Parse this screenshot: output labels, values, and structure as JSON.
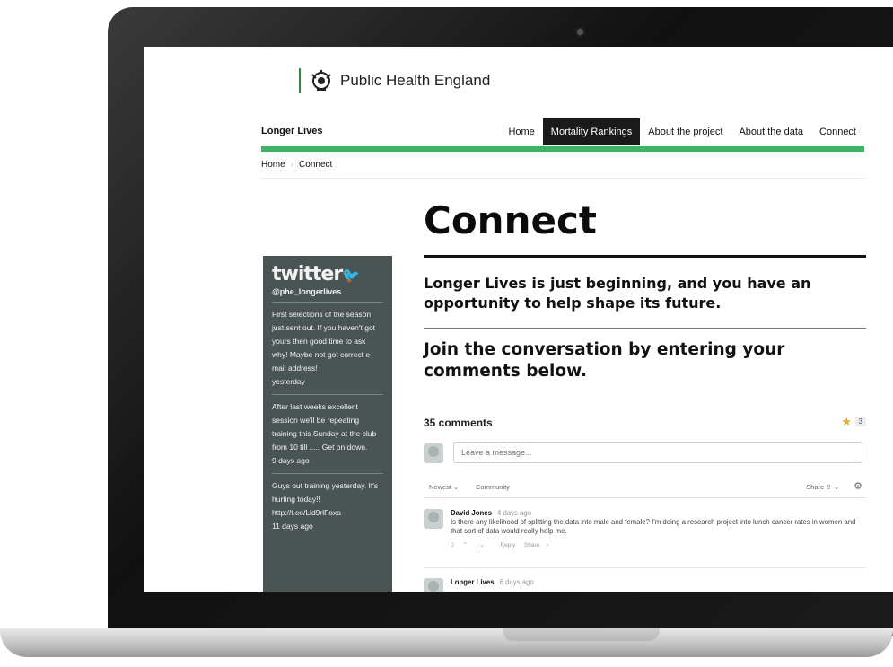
{
  "brand": {
    "name": "Public Health England"
  },
  "nav": {
    "site_name": "Longer Lives",
    "items": [
      {
        "label": "Home"
      },
      {
        "label": "Mortality Rankings",
        "active": true
      },
      {
        "label": "About the project"
      },
      {
        "label": "About the data"
      },
      {
        "label": "Connect"
      }
    ],
    "accent": "#3db364"
  },
  "breadcrumb": [
    "Home",
    "Connect"
  ],
  "page": {
    "title": "Connect",
    "lead": "Longer Lives is just beginning, and you have an opportunity to help shape its future.",
    "lead2": "Join the conversation by entering your comments below."
  },
  "twitter": {
    "logo": "twitter",
    "handle": "@phe_longerlives",
    "tweets": [
      {
        "text": "First selections of the season just sent out. If you haven't got yours then good time to ask why! Maybe not got correct e-mail address!",
        "time": "yesterday"
      },
      {
        "text": "After last weeks excellent session we'll be repeating training this Sunday at the club from 10 till ..... Get on down.",
        "time": "9 days ago"
      },
      {
        "text": "Guys out training yesterday. It's hurting today!! http://t.co/Lid9rlFoxa",
        "time": "11 days ago"
      }
    ]
  },
  "comments": {
    "count_label": "35 comments",
    "star_count": "3",
    "placeholder": "Leave a message...",
    "sort": {
      "newest": "Newest",
      "community": "Community",
      "share": "Share"
    },
    "list": [
      {
        "author": "David Jones",
        "time": "4 days ago",
        "text": "Is there any likelihood of splitting the data into male and female? I'm doing a research project into lunch cancer rates in women and that sort of data would really help me.",
        "votes": "0",
        "reply": "Reply",
        "share": "Share"
      },
      {
        "author": "Longer Lives",
        "time": "6 days ago"
      }
    ]
  }
}
